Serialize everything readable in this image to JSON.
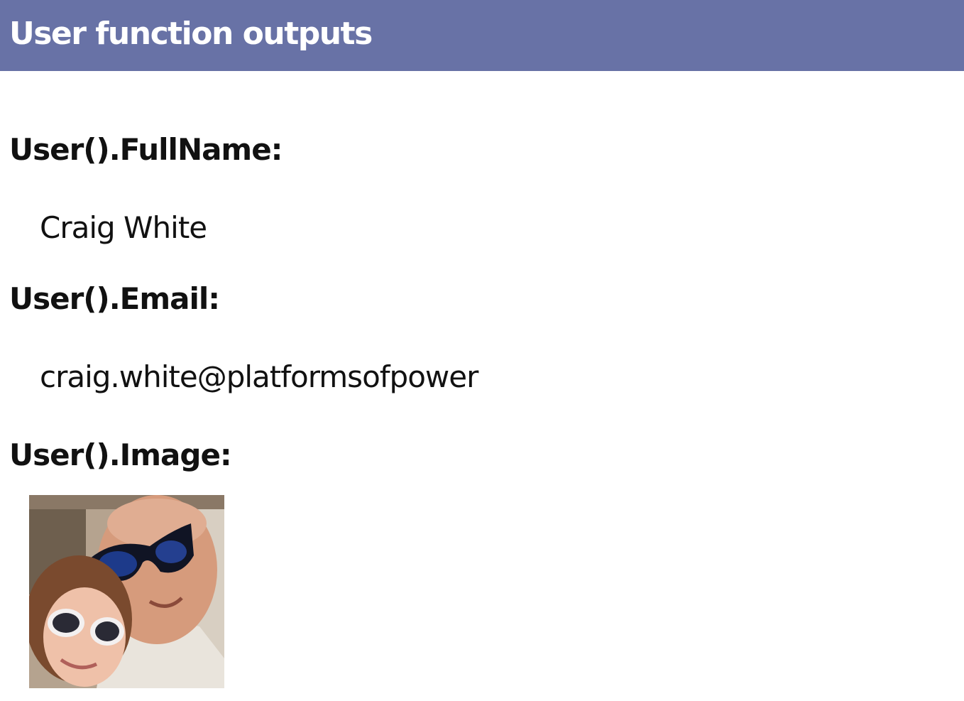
{
  "header": {
    "title": "User function outputs"
  },
  "fields": {
    "fullname": {
      "label": "User().FullName:",
      "value": "Craig White"
    },
    "email": {
      "label": "User().Email:",
      "value": "craig.white@platformsofpower"
    },
    "image": {
      "label": "User().Image:"
    }
  },
  "colors": {
    "header_bg": "#6872a6",
    "header_text": "#ffffff",
    "body_text": "#111111"
  }
}
